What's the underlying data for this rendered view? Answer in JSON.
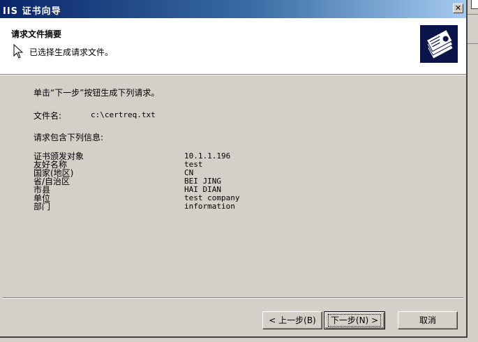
{
  "window": {
    "title": "IIS 证书向导",
    "close_glyph": "✕"
  },
  "header": {
    "title": "请求文件摘要",
    "subtitle": "已选择生成请求文件。"
  },
  "body": {
    "instruction": "单击“下一步”按钮生成下列请求。",
    "filename_label": "文件名:",
    "filename_value": "c:\\certreq.txt",
    "info_heading": "请求包含下列信息:",
    "info": [
      {
        "label": "证书颁发对象",
        "value": "10.1.1.196"
      },
      {
        "label": "友好名称",
        "value": "test"
      },
      {
        "label": "国家(地区)",
        "value": "CN"
      },
      {
        "label": "省/自治区",
        "value": "BEI JING"
      },
      {
        "label": "市县",
        "value": "HAI DIAN"
      },
      {
        "label": "单位",
        "value": "test company"
      },
      {
        "label": "部门",
        "value": "information"
      }
    ]
  },
  "buttons": {
    "back": "< 上一步(B)",
    "next": "下一步(N) >",
    "cancel": "取消"
  },
  "colors": {
    "titlebar_start": "#0a246a",
    "titlebar_end": "#a6caf0",
    "dialog_face": "#d4d0c8"
  },
  "icons": {
    "pointer": "arrow-pointer-icon",
    "wizard": "certificate-wizard-icon",
    "close": "close-icon"
  }
}
